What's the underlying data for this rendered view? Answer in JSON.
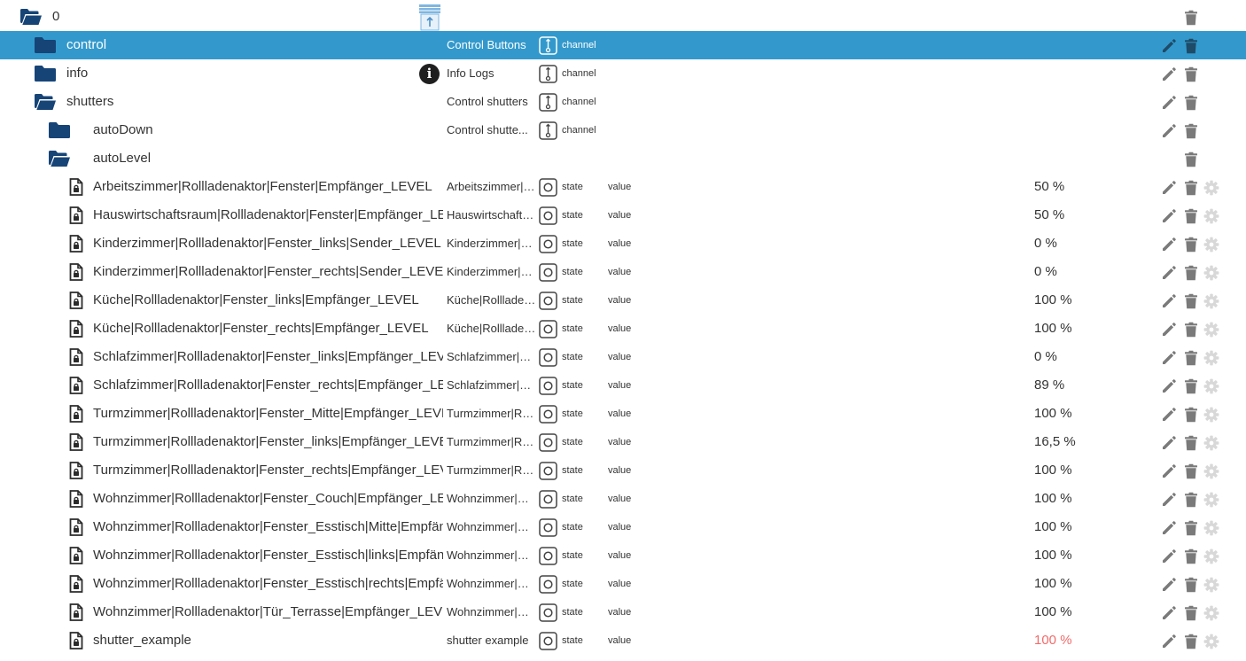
{
  "colors": {
    "selected_row_bg": "#3399cc",
    "folder": "#164477",
    "alert_value": "#f26b6b",
    "action_icon": "#7a7a7a",
    "disabled_icon": "#d8d8d8"
  },
  "root": {
    "name": "0",
    "icon": "folder-open-icon",
    "logo": "shutter-adapter-logo"
  },
  "channels": [
    {
      "name": "control",
      "description": "Control Buttons",
      "type": "channel",
      "icon": "folder-closed-icon",
      "selected": true
    },
    {
      "name": "info",
      "description": "Info Logs",
      "type": "channel",
      "icon": "folder-closed-icon",
      "badge": "i"
    },
    {
      "name": "shutters",
      "description": "Control shutters",
      "type": "channel",
      "icon": "folder-open-icon"
    },
    {
      "name": "autoDown",
      "description": "Control shutte...",
      "type": "channel",
      "icon": "folder-closed-icon"
    },
    {
      "name": "autoLevel",
      "icon": "folder-open-icon"
    }
  ],
  "states": [
    {
      "name": "Arbeitszimmer|Rollladenaktor|Fenster|Empfänger_LEVEL",
      "description": "Arbeitszimmer|Rollladenaktor|Fenster|Empfänger_LEVEL",
      "type": "state",
      "role": "value",
      "value": "50 %"
    },
    {
      "name": "Hauswirtschaftsraum|Rollladenaktor|Fenster|Empfänger_LEVEL",
      "description": "Hauswirtschaftsraum|Rollladenaktor|Fenster|Empfänger_LEVEL",
      "type": "state",
      "role": "value",
      "value": "50 %"
    },
    {
      "name": "Kinderzimmer|Rollladenaktor|Fenster_links|Sender_LEVEL",
      "description": "Kinderzimmer|Rollladenaktor|Fenster_links|Sender_LEVEL",
      "type": "state",
      "role": "value",
      "value": "0 %"
    },
    {
      "name": "Kinderzimmer|Rollladenaktor|Fenster_rechts|Sender_LEVEL",
      "description": "Kinderzimmer|Rollladenaktor|Fenster_rechts|Sender_LEVEL",
      "type": "state",
      "role": "value",
      "value": "0 %"
    },
    {
      "name": "Küche|Rollladenaktor|Fenster_links|Empfänger_LEVEL",
      "description": "Küche|Rollladenaktor|Fenster_links|Empfänger_LEVEL",
      "type": "state",
      "role": "value",
      "value": "100 %"
    },
    {
      "name": "Küche|Rollladenaktor|Fenster_rechts|Empfänger_LEVEL",
      "description": "Küche|Rollladenaktor|Fenster_rechts|Empfänger_LEVEL",
      "type": "state",
      "role": "value",
      "value": "100 %"
    },
    {
      "name": "Schlafzimmer|Rollladenaktor|Fenster_links|Empfänger_LEVEL",
      "description": "Schlafzimmer|Rollladenaktor|Fenster_links|Empfänger_LEVEL",
      "type": "state",
      "role": "value",
      "value": "0 %"
    },
    {
      "name": "Schlafzimmer|Rollladenaktor|Fenster_rechts|Empfänger_LEVEL",
      "description": "Schlafzimmer|Rollladenaktor|Fenster_rechts|Empfänger_LEVEL",
      "type": "state",
      "role": "value",
      "value": "89 %"
    },
    {
      "name": "Turmzimmer|Rollladenaktor|Fenster_Mitte|Empfänger_LEVEL",
      "description": "Turmzimmer|Rollladenaktor|Fenster_Mitte|Empfänger_LEVEL",
      "type": "state",
      "role": "value",
      "value": "100 %"
    },
    {
      "name": "Turmzimmer|Rollladenaktor|Fenster_links|Empfänger_LEVEL",
      "description": "Turmzimmer|Rollladenaktor|Fenster_links|Empfänger_LEVEL",
      "type": "state",
      "role": "value",
      "value": "16,5 %"
    },
    {
      "name": "Turmzimmer|Rollladenaktor|Fenster_rechts|Empfänger_LEVEL",
      "description": "Turmzimmer|Rollladenaktor|Fenster_rechts|Empfänger_LEVEL",
      "type": "state",
      "role": "value",
      "value": "100 %"
    },
    {
      "name": "Wohnzimmer|Rollladenaktor|Fenster_Couch|Empfänger_LEVEL",
      "description": "Wohnzimmer|Rollladenaktor|Fenster_Couch|Empfänger_LEVEL",
      "type": "state",
      "role": "value",
      "value": "100 %"
    },
    {
      "name": "Wohnzimmer|Rollladenaktor|Fenster_Esstisch|Mitte|Empfänger_LEVEL",
      "description": "Wohnzimmer|Rollladenaktor|Fenster_Esstisch|Mitte|Empfänger_LEVEL",
      "type": "state",
      "role": "value",
      "value": "100 %"
    },
    {
      "name": "Wohnzimmer|Rollladenaktor|Fenster_Esstisch|links|Empfänger_LEVEL",
      "description": "Wohnzimmer|Rollladenaktor|Fenster_Esstisch|links|Empfänger_LEVEL",
      "type": "state",
      "role": "value",
      "value": "100 %"
    },
    {
      "name": "Wohnzimmer|Rollladenaktor|Fenster_Esstisch|rechts|Empfänger_LEVEL",
      "description": "Wohnzimmer|Rollladenaktor|Fenster_Esstisch|rechts|Empfänger_LEVEL",
      "type": "state",
      "role": "value",
      "value": "100 %"
    },
    {
      "name": "Wohnzimmer|Rollladenaktor|Tür_Terrasse|Empfänger_LEVEL",
      "description": "Wohnzimmer|Rollladenaktor|Tür_Terrasse|Empfänger_LEVEL",
      "type": "state",
      "role": "value",
      "value": "100 %"
    },
    {
      "name": "shutter_example",
      "description": "shutter example",
      "type": "state",
      "role": "value",
      "value": "100 %",
      "alert": true
    }
  ]
}
